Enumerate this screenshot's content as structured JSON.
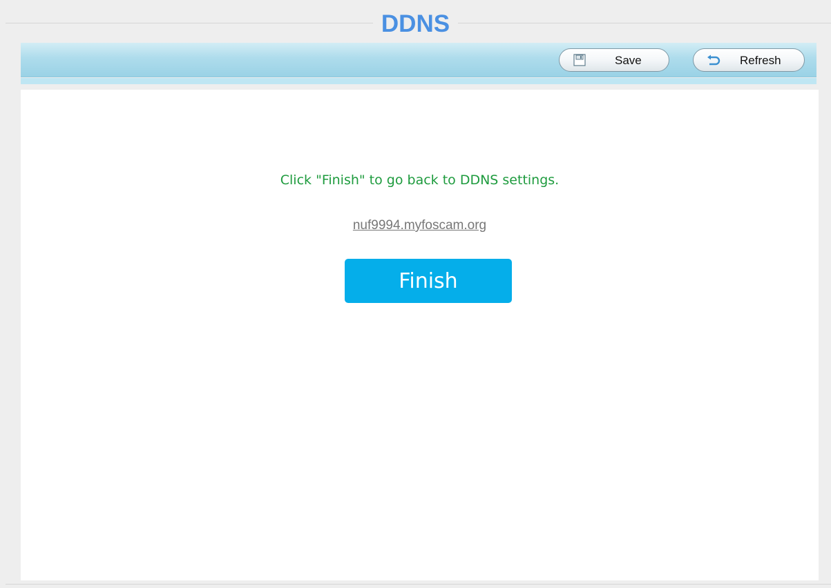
{
  "page": {
    "title": "DDNS"
  },
  "toolbar": {
    "save_label": "Save",
    "save_icon": "floppy-disk-icon",
    "refresh_label": "Refresh",
    "refresh_icon": "undo-arrow-icon"
  },
  "main": {
    "message": "Click \"Finish\" to go back to DDNS settings.",
    "domain_link": "nuf9994.myfoscam.org",
    "finish_label": "Finish"
  },
  "colors": {
    "title": "#4a90e2",
    "toolbar": "#aedcec",
    "message": "#1e9b3e",
    "link": "#777777",
    "finish_button": "#05aeea"
  }
}
